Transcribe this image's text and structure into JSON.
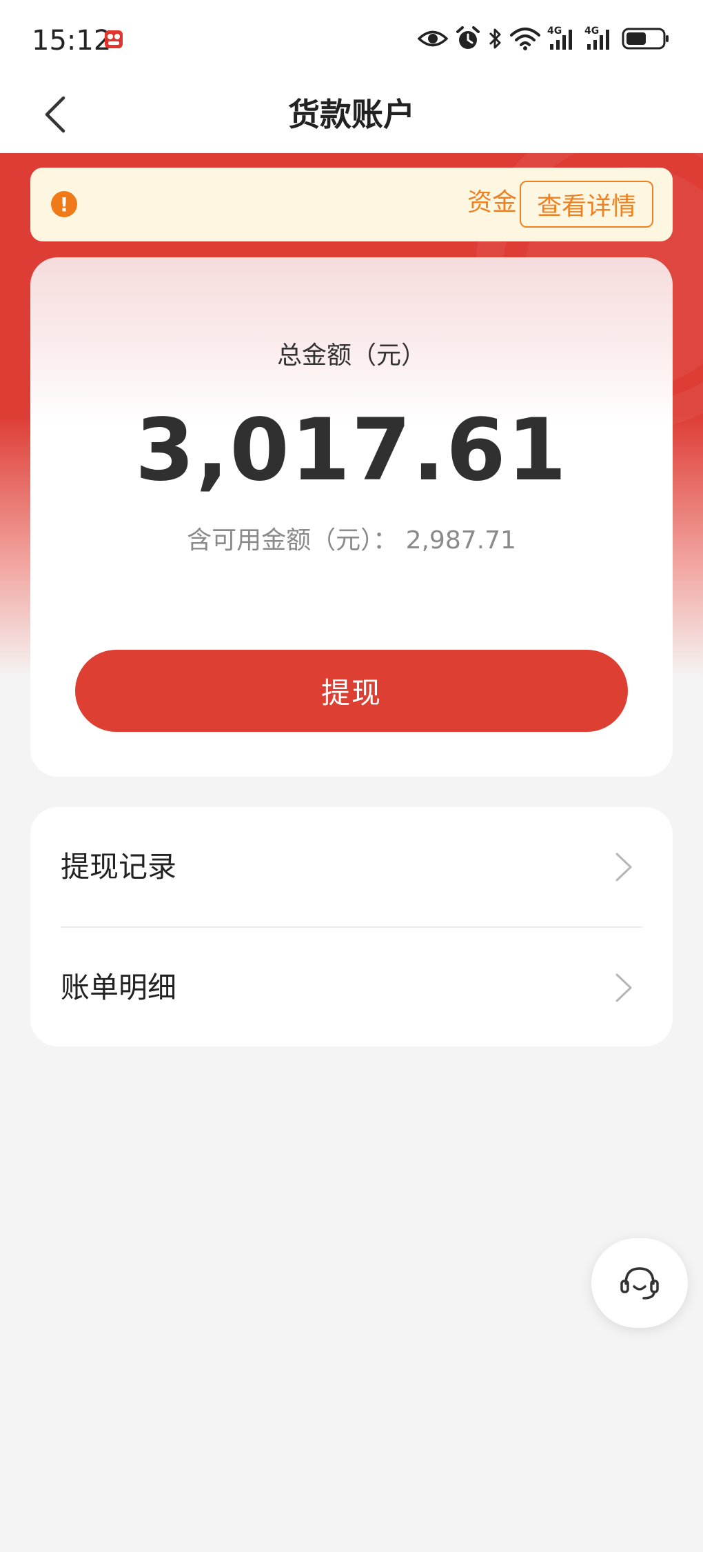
{
  "status_bar": {
    "time": "15:12",
    "icons": [
      "eye-icon",
      "alarm-icon",
      "bluetooth-icon",
      "wifi-icon",
      "signal-4g-icon",
      "signal-4g-icon",
      "battery-icon"
    ],
    "signal_label_1": "4G",
    "signal_label_2": "4G"
  },
  "nav": {
    "title": "货款账户",
    "back_icon": "chevron-left-icon"
  },
  "notice": {
    "icon": "exclamation-icon",
    "text": "资金",
    "button_label": "查看详情",
    "accent_color": "#ee8222"
  },
  "balance": {
    "total_label": "总金额（元）",
    "total_amount": "3,017.61",
    "available_label": "含可用金额（元）：",
    "available_amount": "2,987.71",
    "withdraw_label": "提现",
    "brand_color": "#dd4033"
  },
  "menu": {
    "items": [
      {
        "label": "提现记录",
        "icon": "chevron-right-icon"
      },
      {
        "label": "账单明细",
        "icon": "chevron-right-icon"
      }
    ]
  },
  "service": {
    "icon": "headset-icon"
  }
}
